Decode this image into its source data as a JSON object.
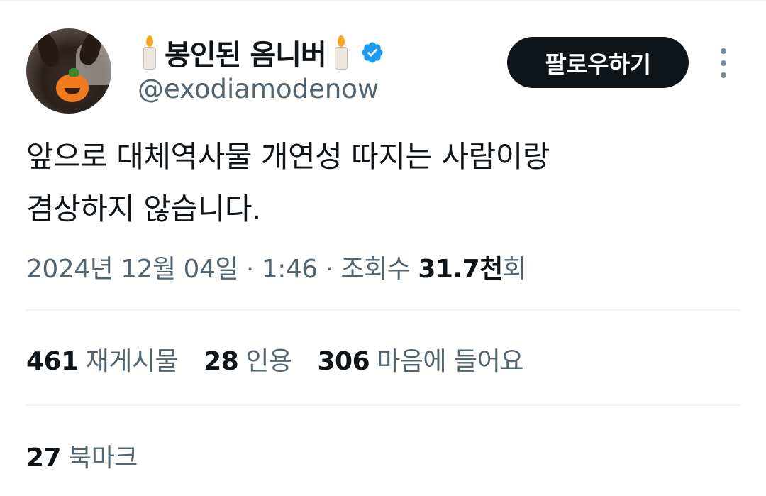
{
  "author": {
    "display_name": "봉인된 옴니버",
    "handle": "@exodiamodenow",
    "verified": true,
    "name_decoration_icon": "candle-icon",
    "avatar_icon": "black-cat-with-pumpkin-avatar"
  },
  "actions": {
    "follow_label": "팔로우하기",
    "more_icon": "more-vertical-icon"
  },
  "tweet": {
    "lines": [
      "앞으로 대체역사물 개연성 따지는 사람이랑",
      "겸상하지 않습니다."
    ]
  },
  "meta": {
    "date": "2024년 12월 04일",
    "separator": " · ",
    "time": "1:46",
    "views_prefix": "조회수 ",
    "views_value": "31.7천",
    "views_suffix": "회"
  },
  "stats": {
    "reposts_count": "461",
    "reposts_label": "재게시물",
    "quotes_count": "28",
    "quotes_label": "인용",
    "likes_count": "306",
    "likes_label": "마음에 들어요",
    "bookmarks_count": "27",
    "bookmarks_label": "북마크"
  },
  "colors": {
    "text_primary": "#0f1419",
    "text_secondary": "#536471",
    "verified_blue": "#1d9bf0",
    "divider": "#eff3f4"
  }
}
